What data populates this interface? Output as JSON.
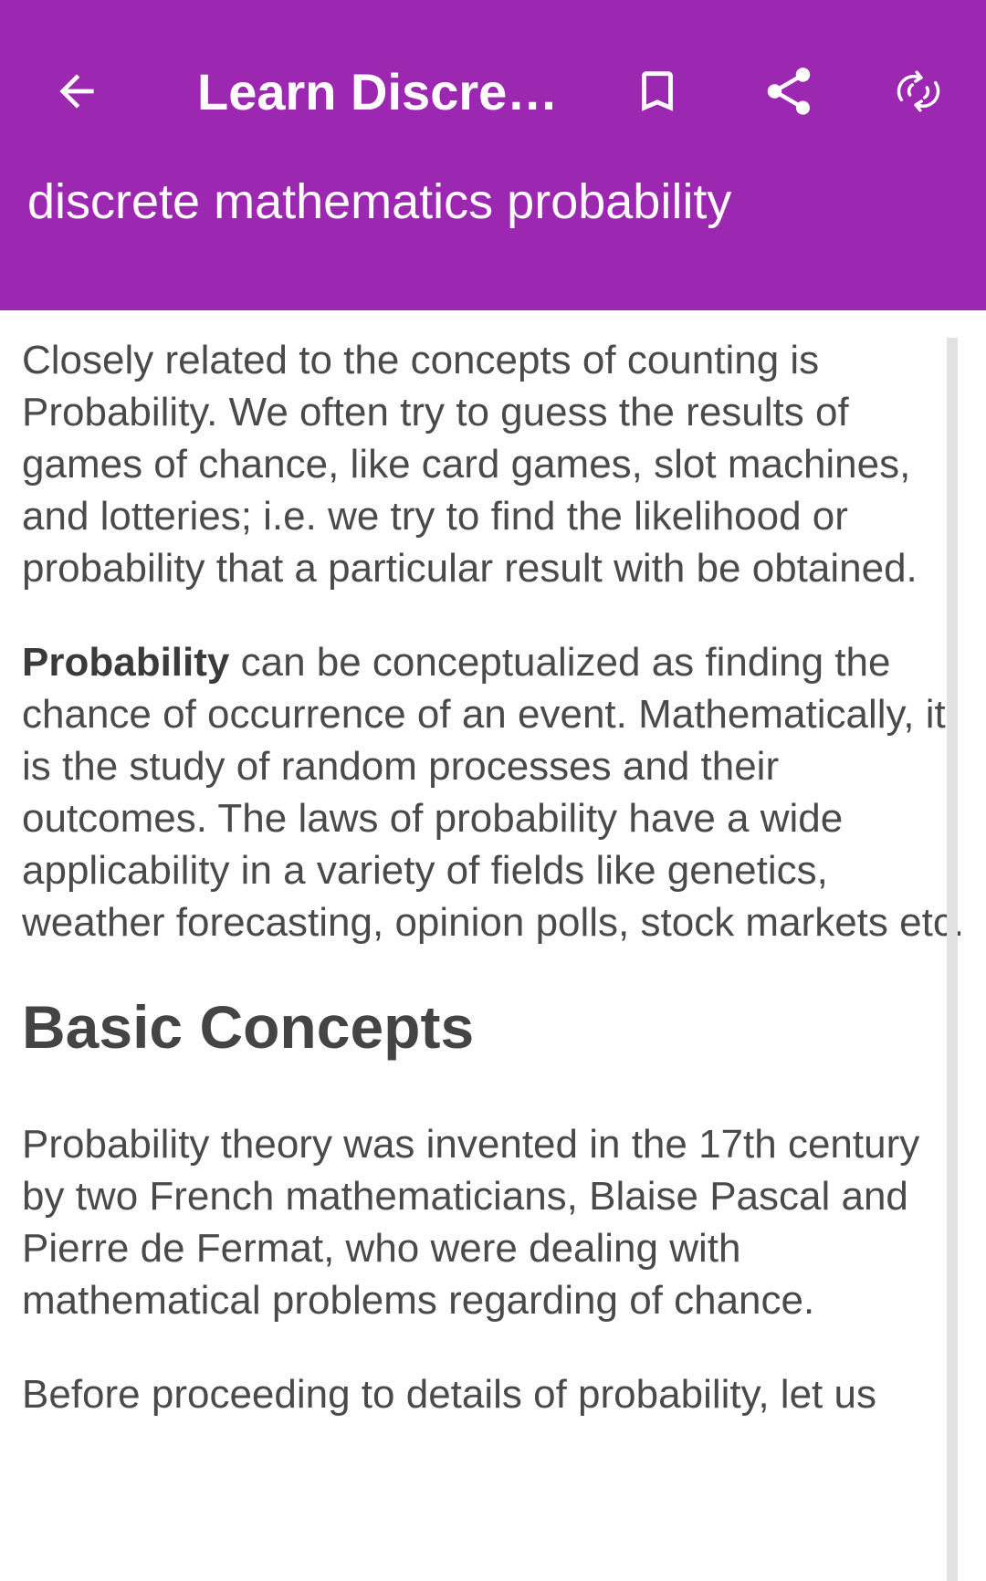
{
  "header": {
    "title": "Learn Discret...",
    "subtitle": "discrete mathematics probability",
    "icons": {
      "back": "arrow-back-icon",
      "bookmark": "bookmark-icon",
      "share": "share-icon",
      "sync": "sync-icon"
    },
    "accent_color": "#9c27b0"
  },
  "article": {
    "p1": "Closely related to the concepts of counting is Probability. We often try to guess the results of games of chance, like card games, slot machines, and lotteries; i.e. we try to find the likelihood or probability that a particular result with be obtained.",
    "p2_bold": "Probability",
    "p2_rest": " can be conceptualized as finding the chance of occurrence of an event. Mathematically, it is the study of random processes and their outcomes. The laws of probability have a wide applicability in a variety of fields like genetics, weather forecasting, opinion polls, stock markets etc.",
    "heading": "Basic Concepts",
    "p3": "Probability theory was invented in the 17th century by two French mathematicians, Blaise Pascal and Pierre de Fermat, who were dealing with mathematical problems regarding of chance.",
    "p4": "Before proceeding to details of probability, let us"
  }
}
